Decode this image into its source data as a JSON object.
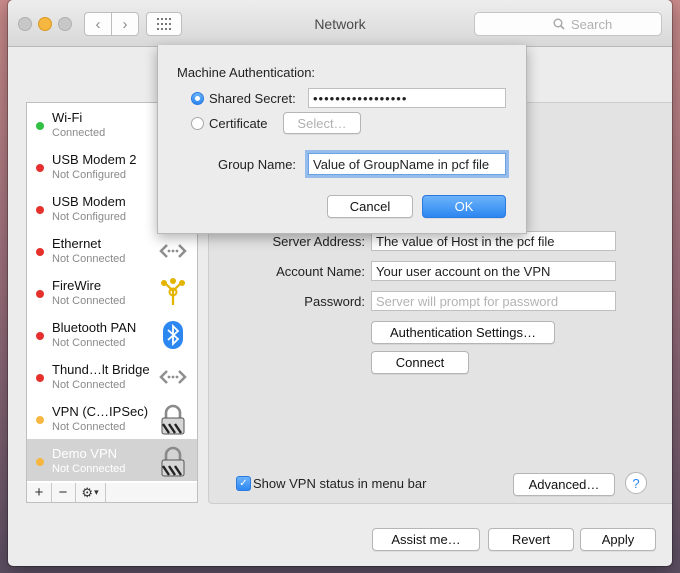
{
  "window": {
    "title": "Network"
  },
  "toolbar": {
    "back_icon": "chevron-left-icon",
    "forward_icon": "chevron-right-icon",
    "grid_icon": "grid-icon",
    "search_placeholder": "Search"
  },
  "sidebar": {
    "items": [
      {
        "name": "Wi-Fi",
        "status": "Connected",
        "dot": "#32c146",
        "icon": "none"
      },
      {
        "name": "USB Modem 2",
        "status": "Not Configured",
        "dot": "#e5302c",
        "icon": "none"
      },
      {
        "name": "USB Modem",
        "status": "Not Configured",
        "dot": "#e5302c",
        "icon": "none"
      },
      {
        "name": "Ethernet",
        "status": "Not Connected",
        "dot": "#e5302c",
        "icon": "ethernet-icon"
      },
      {
        "name": "FireWire",
        "status": "Not Connected",
        "dot": "#e5302c",
        "icon": "firewire-icon"
      },
      {
        "name": "Bluetooth PAN",
        "status": "Not Connected",
        "dot": "#e5302c",
        "icon": "bluetooth-icon"
      },
      {
        "name": "Thund…lt Bridge",
        "status": "Not Connected",
        "dot": "#e5302c",
        "icon": "ethernet-icon"
      },
      {
        "name": "VPN (C…IPSec)",
        "status": "Not Connected",
        "dot": "#f5b73f",
        "icon": "lock-icon"
      },
      {
        "name": "Demo VPN",
        "status": "Not Connected",
        "dot": "#f5b73f",
        "icon": "lock-icon",
        "selected": true
      }
    ],
    "add_label": "+",
    "remove_label": "−",
    "gear_icon": "gear-icon"
  },
  "form": {
    "server_address_label": "Server Address:",
    "server_address_value": "The value of Host in the pcf file",
    "account_name_label": "Account Name:",
    "account_name_value": "Your user account on the VPN",
    "password_label": "Password:",
    "password_placeholder": "Server will prompt for password",
    "auth_settings_label": "Authentication Settings…",
    "connect_label": "Connect"
  },
  "footer": {
    "show_vpn_status_label": "Show VPN status in menu bar",
    "show_vpn_status_checked": true,
    "advanced_label": "Advanced…",
    "help_label": "?",
    "assist_label": "Assist me…",
    "revert_label": "Revert",
    "apply_label": "Apply"
  },
  "sheet": {
    "heading": "Machine Authentication:",
    "shared_secret_label": "Shared Secret:",
    "shared_secret_value": "•••••••••••••••••",
    "shared_secret_selected": true,
    "certificate_label": "Certificate",
    "select_label": "Select…",
    "group_name_label": "Group Name:",
    "group_name_value": "Value of GroupName in pcf file",
    "cancel_label": "Cancel",
    "ok_label": "OK"
  },
  "colors": {
    "accent": "#2c87f0",
    "connected": "#32c146",
    "not_connected": "#e5302c",
    "not_configured_vpn": "#f5b73f"
  }
}
